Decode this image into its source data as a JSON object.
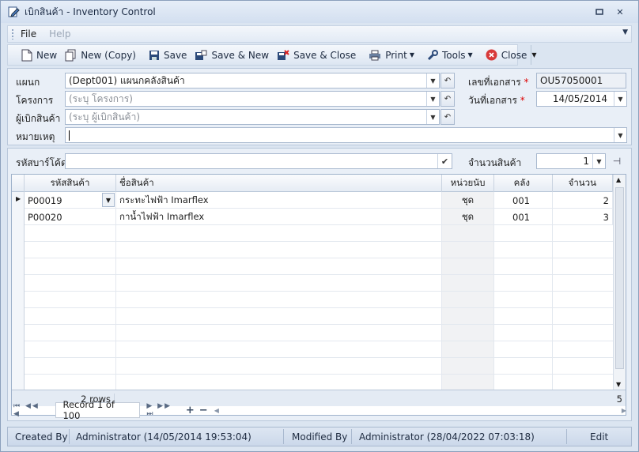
{
  "window": {
    "title": "เบิกสินค้า - Inventory Control",
    "minimize_icon": "restore-icon",
    "close_icon": "close-icon"
  },
  "menu": {
    "file": "File",
    "help": "Help"
  },
  "toolbar": {
    "new": "New",
    "new_copy": "New (Copy)",
    "save": "Save",
    "save_new": "Save & New",
    "save_close": "Save & Close",
    "print": "Print",
    "tools": "Tools",
    "close": "Close"
  },
  "header": {
    "dept_label": "แผนก",
    "dept_value": "(Dept001) แผนกคลังสินค้า",
    "project_label": "โครงการ",
    "project_placeholder": "(ระบุ โครงการ)",
    "requester_label": "ผู้เบิกสินค้า",
    "requester_placeholder": "(ระบุ ผู้เบิกสินค้า)",
    "note_label": "หมายเหตุ",
    "note_value": "",
    "docno_label": "เลขที่เอกสาร",
    "docno_value": "OU57050001",
    "docdate_label": "วันที่เอกสาร",
    "docdate_value": "14/05/2014",
    "required_mark": "*"
  },
  "scan": {
    "barcode_label": "รหัสบาร์โค้ด",
    "barcode_value": "",
    "qty_label": "จำนวนสินค้า",
    "qty_value": "1"
  },
  "grid": {
    "columns": [
      "รหัสสินค้า",
      "ชื่อสินค้า",
      "หน่วยนับ",
      "คลัง",
      "จำนวน"
    ],
    "rows": [
      {
        "code": "P00019",
        "name": "กระทะไฟฟ้า Imarflex",
        "unit": "ชุด",
        "wh": "001",
        "qty": "2"
      },
      {
        "code": "P00020",
        "name": "กาน้ำไฟฟ้า Imarflex",
        "unit": "ชุด",
        "wh": "001",
        "qty": "3"
      }
    ],
    "footer_rows": "2 rows",
    "footer_total": "5",
    "record_text": "Record 1 of 100"
  },
  "status": {
    "created_by_label": "Created By",
    "created_by_value": "Administrator (14/05/2014 19:53:04)",
    "modified_by_label": "Modified By",
    "modified_by_value": "Administrator (28/04/2022 07:03:18)",
    "mode": "Edit"
  }
}
